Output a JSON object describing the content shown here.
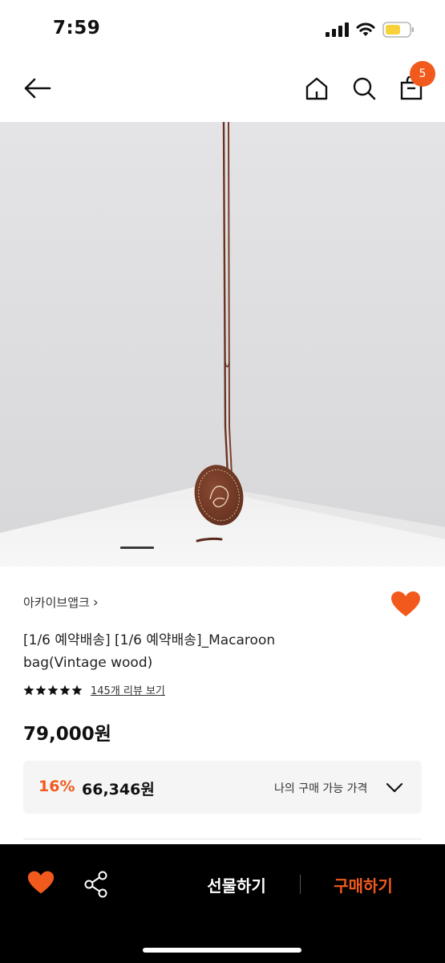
{
  "status_bar": {
    "time": "7:59"
  },
  "top_nav": {
    "icons": [
      "back-arrow-icon",
      "home-icon",
      "search-icon",
      "shopping-bag-icon"
    ],
    "cart_count": "5"
  },
  "product": {
    "image_icon": "macaroon-bag-product-photo",
    "slide_indicator": "1",
    "brand": "아카이브앱크",
    "brand_chevron": "›",
    "title": "[1/6 예약배송] [1/6 예약배송]_Macaroon bag(Vintage wood)",
    "rating": 5,
    "review_link": "145개 리뷰 보기",
    "price": "79,000원"
  },
  "discount": {
    "rate": "16%",
    "price": "66,346원",
    "label": "나의 구매 가능 가격"
  },
  "bottom_bar": {
    "gift_label": "선물하기",
    "buy_label": "구매하기"
  },
  "colors": {
    "accent": "#f25a1d",
    "bottom_bar_bg": "#000000",
    "discount_box_bg": "#f5f5f6"
  }
}
